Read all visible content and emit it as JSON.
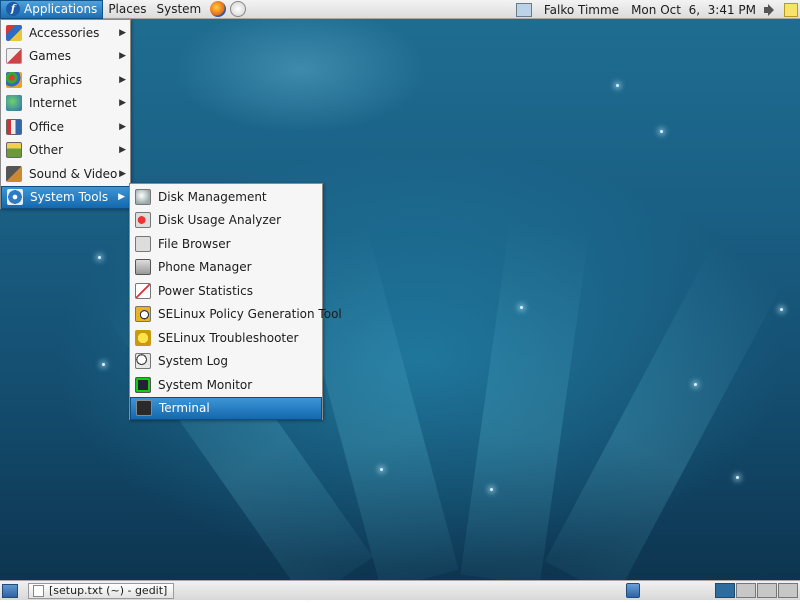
{
  "top_panel": {
    "menus": [
      "Applications",
      "Places",
      "System"
    ],
    "launchers": [
      "firefox-icon",
      "mail-icon"
    ],
    "user": "Falko Timme",
    "clock": "Mon Oct  6,  3:41 PM"
  },
  "applications_menu": {
    "items": [
      {
        "label": "Accessories",
        "icon": "accessories-icon"
      },
      {
        "label": "Games",
        "icon": "games-icon"
      },
      {
        "label": "Graphics",
        "icon": "graphics-icon"
      },
      {
        "label": "Internet",
        "icon": "internet-icon"
      },
      {
        "label": "Office",
        "icon": "office-icon"
      },
      {
        "label": "Other",
        "icon": "other-icon"
      },
      {
        "label": "Sound & Video",
        "icon": "sound-video-icon"
      },
      {
        "label": "System Tools",
        "icon": "system-tools-icon",
        "highlighted": true
      }
    ]
  },
  "system_tools_menu": {
    "items": [
      {
        "label": "Disk Management",
        "icon": "disk-management-icon"
      },
      {
        "label": "Disk Usage Analyzer",
        "icon": "disk-usage-icon"
      },
      {
        "label": "File Browser",
        "icon": "file-browser-icon"
      },
      {
        "label": "Phone Manager",
        "icon": "phone-icon"
      },
      {
        "label": "Power Statistics",
        "icon": "power-statistics-icon"
      },
      {
        "label": "SELinux Policy Generation Tool",
        "icon": "selinux-policy-icon"
      },
      {
        "label": "SELinux Troubleshooter",
        "icon": "selinux-troubleshooter-icon"
      },
      {
        "label": "System Log",
        "icon": "system-log-icon"
      },
      {
        "label": "System Monitor",
        "icon": "system-monitor-icon"
      },
      {
        "label": "Terminal",
        "icon": "terminal-icon",
        "highlighted": true
      }
    ]
  },
  "bottom_panel": {
    "task": "[setup.txt (~) - gedit]",
    "workspaces": 4,
    "active_workspace": 1
  },
  "colors": {
    "highlight": "#1c6fb3",
    "desktop": "#1a5f84"
  }
}
